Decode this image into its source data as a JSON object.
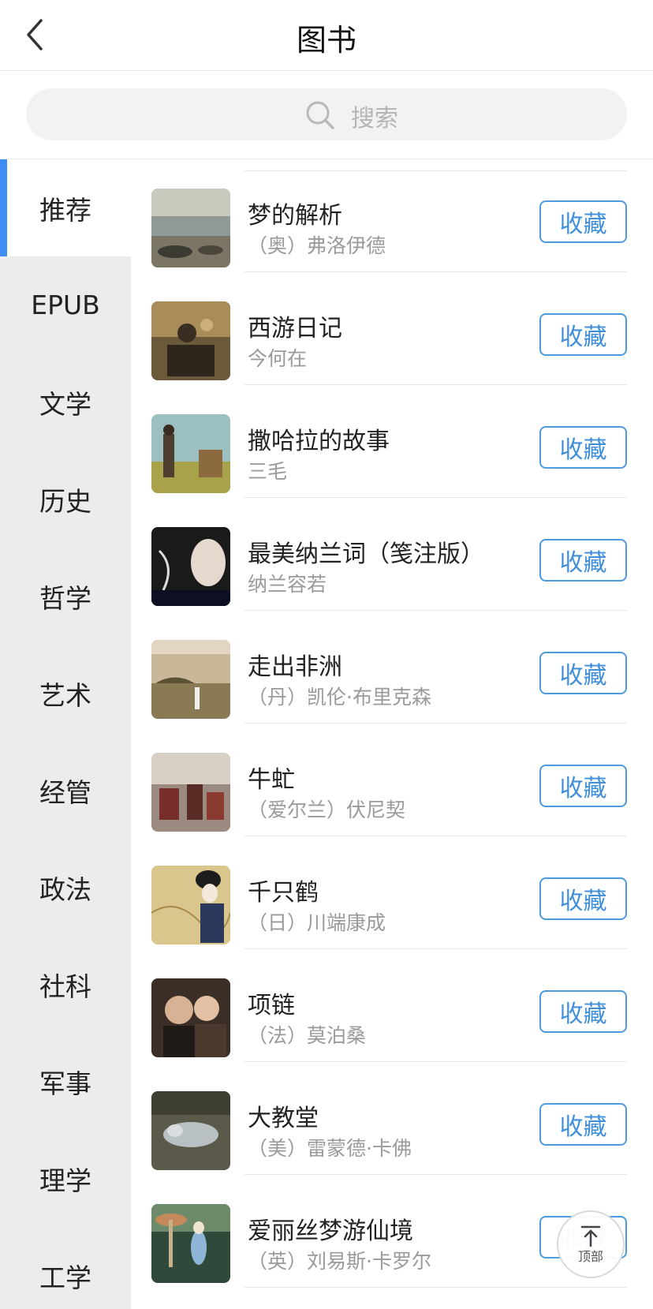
{
  "header": {
    "title": "图书"
  },
  "search": {
    "placeholder": "搜索"
  },
  "sidebar": {
    "items": [
      {
        "label": "推荐",
        "active": true
      },
      {
        "label": "EPUB"
      },
      {
        "label": "文学"
      },
      {
        "label": "历史"
      },
      {
        "label": "哲学"
      },
      {
        "label": "艺术"
      },
      {
        "label": "经管"
      },
      {
        "label": "政法"
      },
      {
        "label": "社科"
      },
      {
        "label": "军事"
      },
      {
        "label": "理学"
      },
      {
        "label": "工学"
      }
    ]
  },
  "books": {
    "fav_label": "收藏",
    "items": [
      {
        "title": "梦的解析",
        "author": "（奥）弗洛伊德"
      },
      {
        "title": "西游日记",
        "author": "今何在"
      },
      {
        "title": "撒哈拉的故事",
        "author": "三毛"
      },
      {
        "title": "最美纳兰词（笺注版）",
        "author": "纳兰容若"
      },
      {
        "title": "走出非洲",
        "author": "（丹）凯伦·布里克森"
      },
      {
        "title": "牛虻",
        "author": "（爱尔兰）伏尼契"
      },
      {
        "title": "千只鹤",
        "author": "（日）川端康成"
      },
      {
        "title": "项链",
        "author": "（法）莫泊桑"
      },
      {
        "title": "大教堂",
        "author": "（美）雷蒙德·卡佛"
      },
      {
        "title": "爱丽丝梦游仙境",
        "author": "（英）刘易斯·卡罗尔"
      }
    ]
  },
  "scroll_top": {
    "label": "顶部"
  },
  "colors": {
    "accent": "#3d8ff5",
    "button": "#3f8fdb",
    "sidebar_bg": "#ececec"
  }
}
